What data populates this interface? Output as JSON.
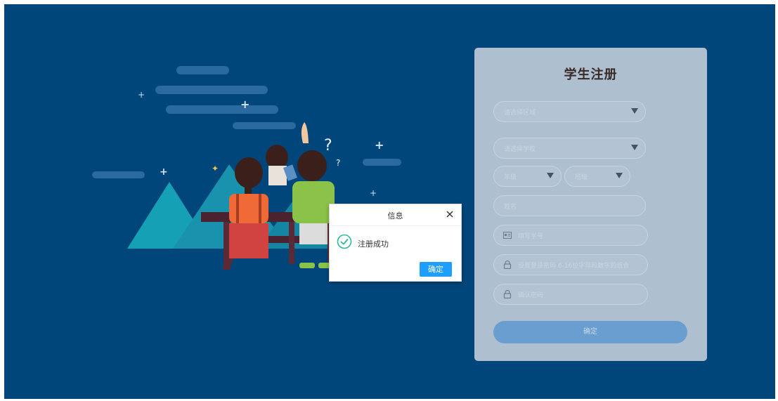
{
  "registration": {
    "title": "学生注册",
    "district_placeholder": "请选择区域",
    "school_placeholder": "请选择学校",
    "grade_placeholder": "年级",
    "class_placeholder": "班级",
    "name_placeholder": "姓名",
    "student_id_placeholder": "填写学号",
    "password_placeholder": "设置登录密码 6-16位字母和数字的组合",
    "confirm_password_placeholder": "确认密码",
    "submit_label": "确定"
  },
  "dialog": {
    "title": "信息",
    "message": "注册成功",
    "ok_label": "确定"
  },
  "colors": {
    "background": "#00467a",
    "primary_button": "#1e9fff",
    "success_icon": "#2fb89a"
  }
}
